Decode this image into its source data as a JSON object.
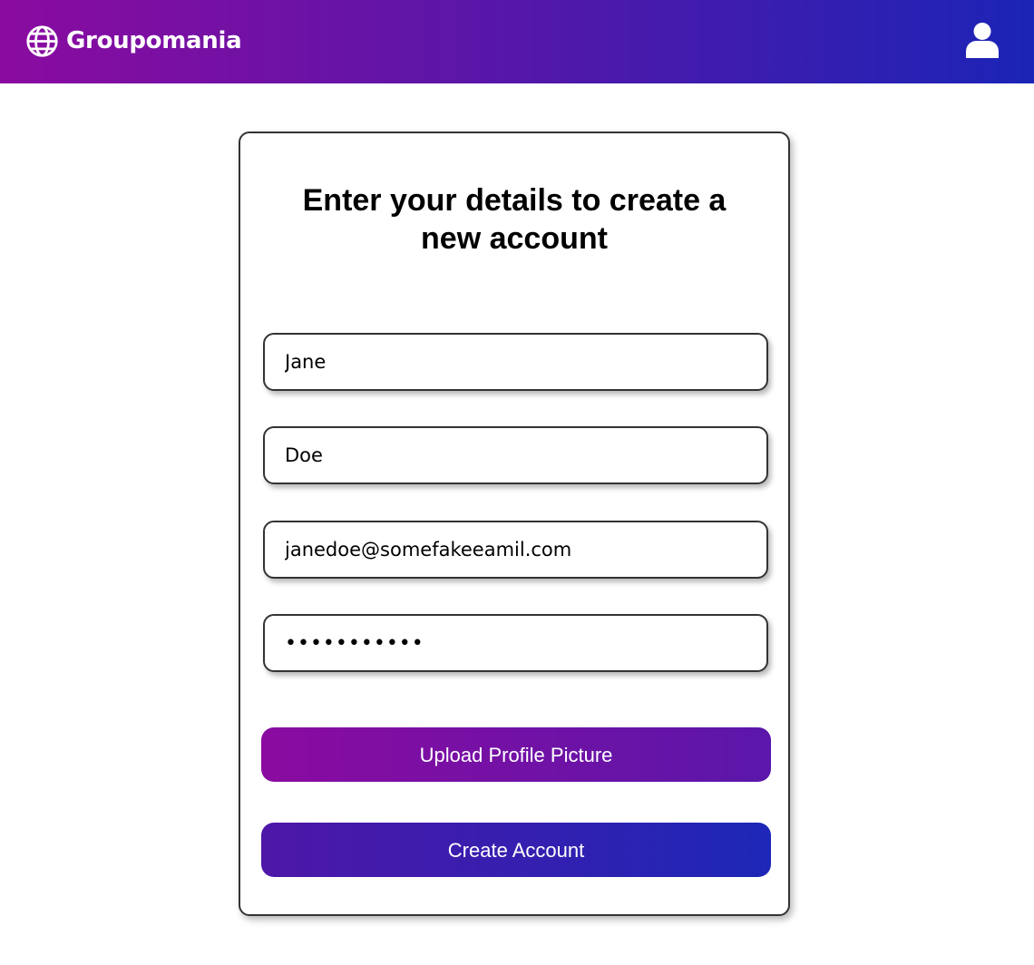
{
  "header": {
    "brand_name": "Groupomania",
    "brand_icon": "globe-icon",
    "user_icon": "user-icon"
  },
  "form": {
    "title": "Enter your details to create a new account",
    "fields": {
      "first_name": "Jane",
      "last_name": "Doe",
      "email": "janedoe@somefakeeamil.com",
      "password": "•••••••••••"
    },
    "upload_label": "Upload Profile Picture",
    "submit_label": "Create Account"
  },
  "colors": {
    "gradient_start": "#8b0ba0",
    "gradient_end": "#1b24b6"
  }
}
